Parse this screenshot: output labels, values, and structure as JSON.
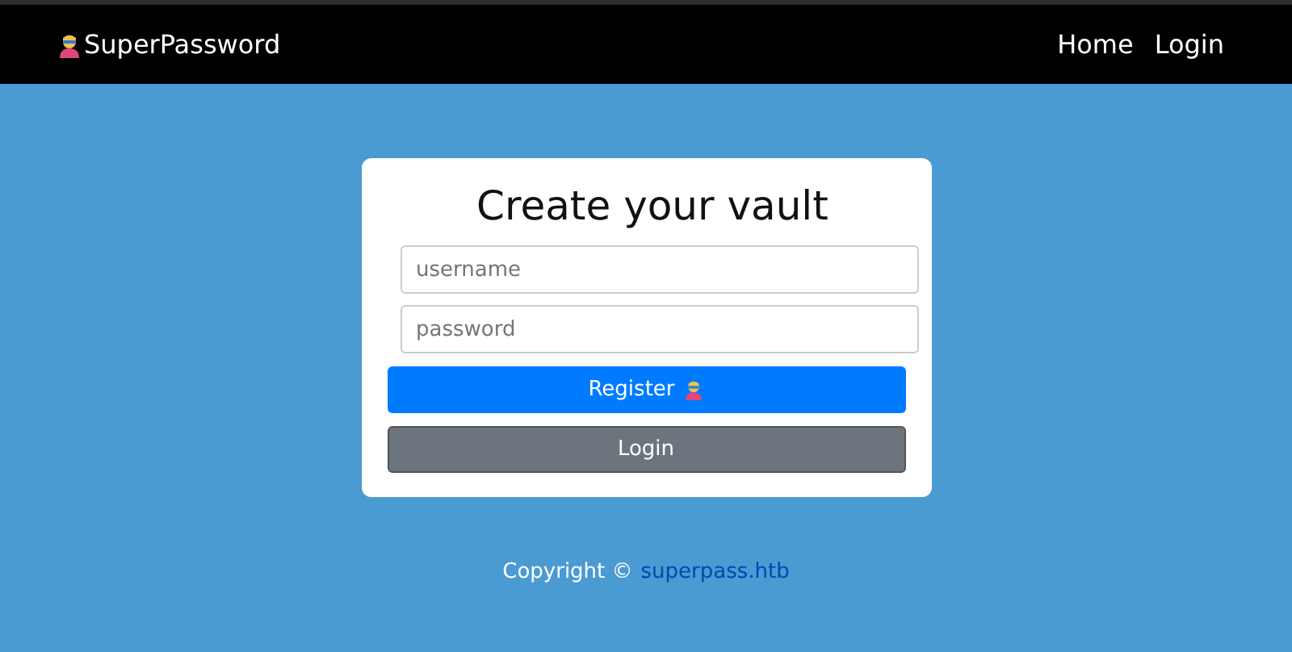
{
  "navbar": {
    "brand": "SuperPassword",
    "links": [
      "Home",
      "Login"
    ]
  },
  "card": {
    "title": "Create your vault",
    "fields": [
      {
        "placeholder": "username"
      },
      {
        "placeholder": "password"
      }
    ],
    "buttons": [
      {
        "label": "Register",
        "kind": "primary",
        "icon": true
      },
      {
        "label": "Login",
        "kind": "secondary",
        "icon": false
      }
    ]
  },
  "footer": {
    "text": "Copyright ©",
    "link": "superpass.htb"
  }
}
